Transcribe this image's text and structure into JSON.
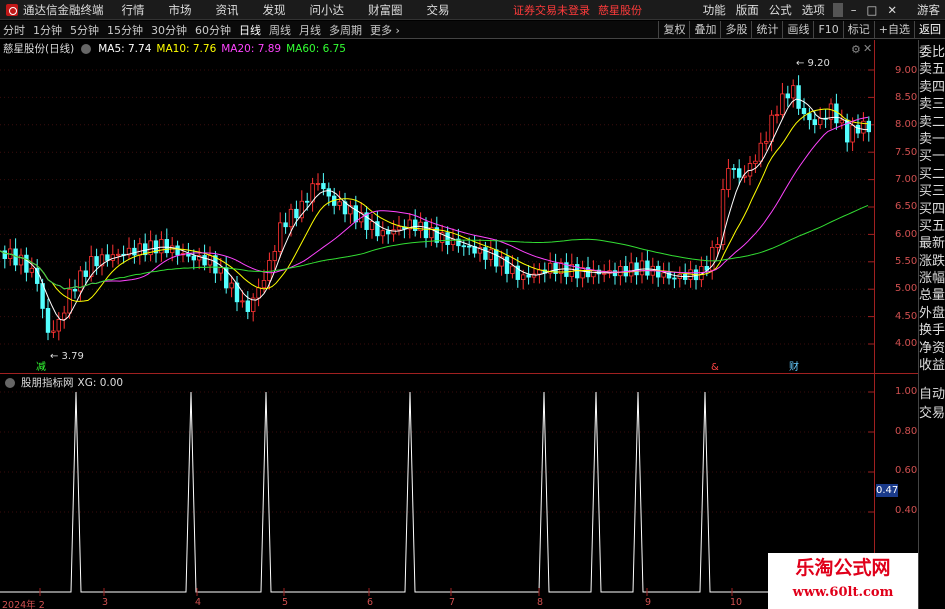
{
  "menubar": {
    "app_title": "通达信金融终端",
    "items": [
      "行情",
      "市场",
      "资讯",
      "发现",
      "问小达",
      "财富圈",
      "交易"
    ],
    "status_text": "证券交易未登录",
    "stock_name": "慈星股份",
    "right_items": [
      "功能",
      "版面",
      "公式",
      "选项"
    ],
    "user": "游客",
    "accent": "#c01818"
  },
  "tabbar": {
    "periods": [
      "分时",
      "1分钟",
      "5分钟",
      "15分钟",
      "30分钟",
      "60分钟",
      "日线",
      "周线",
      "月线",
      "多周期",
      "更多"
    ],
    "active_period": "日线",
    "tools": [
      "复权",
      "叠加",
      "多股",
      "统计",
      "画线",
      "F10",
      "标记",
      "+自选",
      "返回"
    ]
  },
  "main_legend": {
    "title": "慈星股份(日线)",
    "ma5": "MA5: 7.74",
    "ma10": "MA10: 7.76",
    "ma20": "MA20: 7.89",
    "ma60": "MA60: 6.75",
    "colors": {
      "ma5": "#ffffff",
      "ma10": "#ffff00",
      "ma20": "#ff00ff",
      "ma60": "#00ff00"
    }
  },
  "price_axis": [
    "9.00",
    "8.50",
    "8.00",
    "7.50",
    "7.00",
    "6.50",
    "6.00",
    "5.50",
    "5.00",
    "4.50",
    "4.00"
  ],
  "annotations": {
    "high": "9.20",
    "low": "3.79",
    "marker1": "减",
    "marker2": "&",
    "marker3": "财"
  },
  "sub_legend": {
    "title": "股朋指标网",
    "value": "XG: 0.00"
  },
  "sub_axis": [
    "1.00",
    "0.80",
    "0.60",
    "0.40"
  ],
  "sub_current": "0.47",
  "side_panel": [
    "委比",
    "卖五",
    "卖四",
    "卖三",
    "卖二",
    "卖一",
    "买一",
    "买二",
    "买三",
    "买四",
    "买五",
    "最新",
    "涨跌",
    "涨幅",
    "总量",
    "外盘",
    "换手",
    "净资",
    "收益"
  ],
  "side_panel2": [
    "自动",
    "交易"
  ],
  "x_axis": [
    "2024年 2",
    "3",
    "4",
    "5",
    "6",
    "7",
    "8",
    "9",
    "10"
  ],
  "watermark": {
    "line1": "乐淘公式网",
    "line2": "www.60lt.com"
  }
}
